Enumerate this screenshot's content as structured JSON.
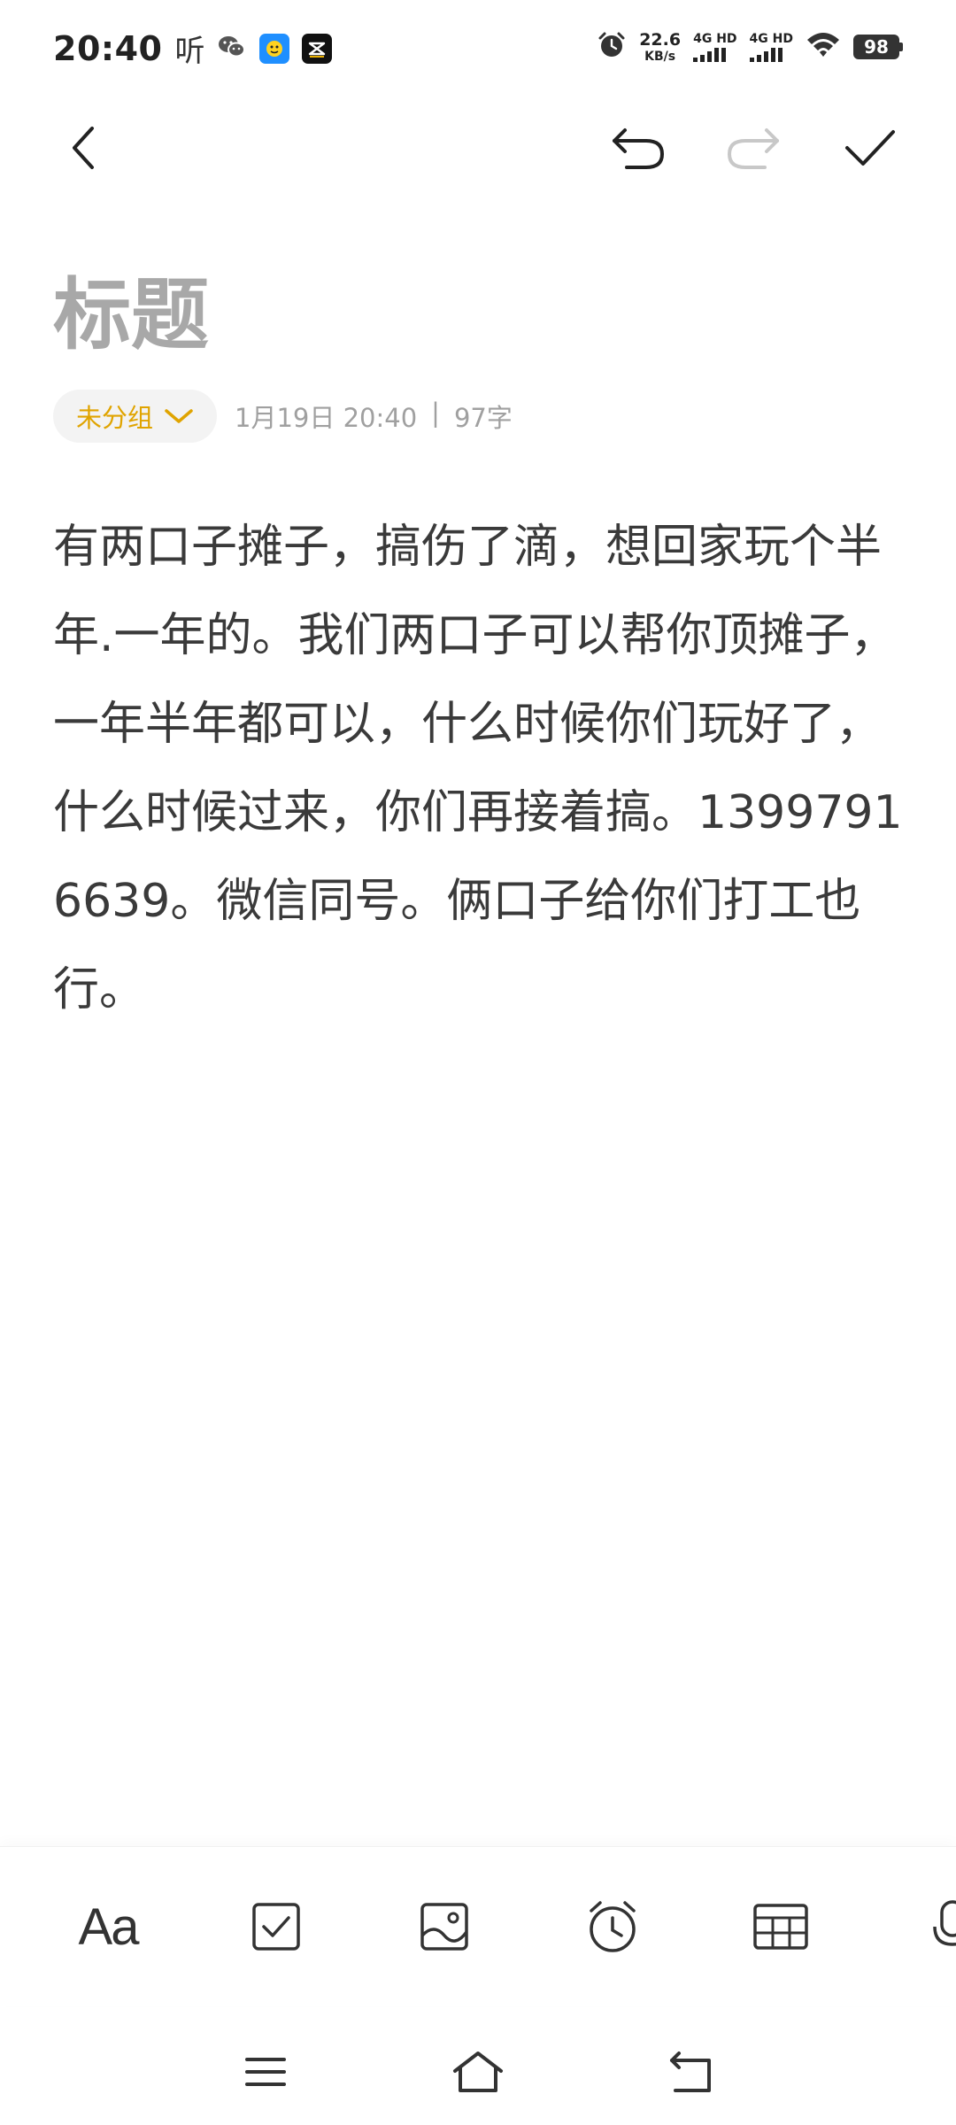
{
  "status_bar": {
    "time": "20:40",
    "ting": "听",
    "net_speed_value": "22.6",
    "net_speed_unit": "KB/s",
    "sim1_label": "4G HD",
    "sim2_label": "4G HD",
    "battery": "98"
  },
  "toolbar": {
    "back_icon": "chevron-left-icon",
    "undo_icon": "undo-icon",
    "redo_icon": "redo-icon",
    "done_icon": "check-icon"
  },
  "note": {
    "title": "标题",
    "group_label": "未分组",
    "date": "1月19日 20:40",
    "separator": "|",
    "word_count": "97字",
    "body": "有两口子摊子，搞伤了滴，想回家玩个半年.一年的。我们两口子可以帮你顶摊子，一年半年都可以，什么时候你们玩好了，什么时候过来，你们再接着搞。13997916639。微信同号。俩口子给你们打工也行。"
  },
  "format_bar": {
    "text_style_label": "Aa",
    "items": [
      "text-style-icon",
      "checkbox-icon",
      "image-icon",
      "alarm-icon",
      "table-icon",
      "microphone-icon"
    ]
  },
  "nav_bar": {
    "items": [
      "menu-icon",
      "home-icon",
      "back-icon"
    ]
  },
  "colors": {
    "accent": "#e0a400",
    "title_placeholder": "#a8a8a8",
    "body_text": "#3a3a3a",
    "meta_text": "#a0a0a0"
  }
}
